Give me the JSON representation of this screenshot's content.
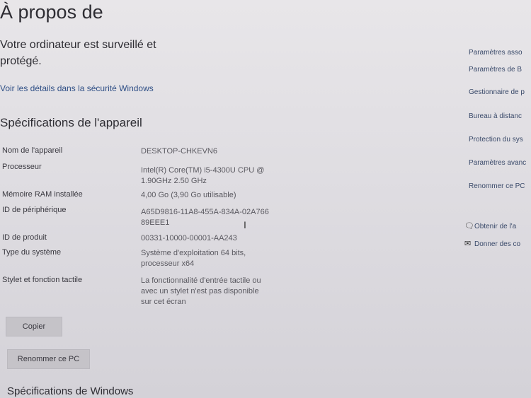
{
  "header": {
    "title": "À propos de",
    "protection_status": "Votre ordinateur est surveillé et protégé.",
    "security_link": "Voir les détails dans la sécurité Windows"
  },
  "device_specs": {
    "section_title": "Spécifications de l'appareil",
    "rows": [
      {
        "label": "Nom de l'appareil",
        "value": "DESKTOP-CHKEVN6"
      },
      {
        "label": "Processeur",
        "value": "Intel(R) Core(TM) i5-4300U CPU @\n1.90GHz   2.50 GHz"
      },
      {
        "label": "Mémoire RAM installée",
        "value": "4,00 Go (3,90 Go utilisable)"
      },
      {
        "label": "ID de périphérique",
        "value": "A65D9816-11A8-455A-834A-02A766\n89EEE1"
      },
      {
        "label": "ID de produit",
        "value": "00331-10000-00001-AA243"
      },
      {
        "label": "Type du système",
        "value": "Système d'exploitation 64 bits,\nprocesseur x64"
      },
      {
        "label": "Stylet et fonction tactile",
        "value": "La fonctionnalité d'entrée tactile ou\navec un stylet n'est pas disponible\nsur cet écran"
      }
    ],
    "copy_button": "Copier",
    "rename_button": "Renommer ce PC"
  },
  "windows_specs": {
    "section_title": "Spécifications de Windows"
  },
  "related_settings": {
    "links": [
      "Paramètres asso",
      "Paramètres de B",
      "Gestionnaire de p",
      "Bureau à distanc",
      "Protection du sys",
      "Paramètres avanc",
      "Renommer ce PC"
    ]
  },
  "help": {
    "items": [
      {
        "icon": "help-chat-icon",
        "label": "Obtenir de l'a"
      },
      {
        "icon": "feedback-icon",
        "label": "Donner des co"
      }
    ]
  }
}
